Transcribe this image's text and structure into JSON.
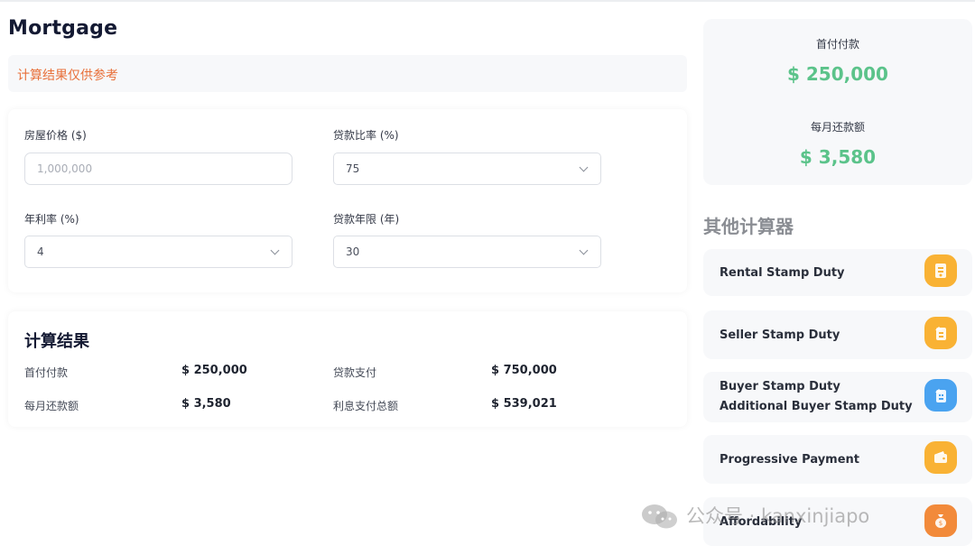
{
  "page": {
    "title": "Mortgage",
    "notice": "计算结果仅供参考"
  },
  "form": {
    "house_price": {
      "label": "房屋价格 ($)",
      "value": "",
      "placeholder": "1,000,000"
    },
    "loan_ratio": {
      "label": "贷款比率 (%)",
      "value": "75"
    },
    "annual_rate": {
      "label": "年利率 (%)",
      "value": "4"
    },
    "loan_term": {
      "label": "贷款年限 (年)",
      "value": "30"
    }
  },
  "results": {
    "title": "计算结果",
    "down_payment": {
      "label": "首付付款",
      "value": "$ 250,000"
    },
    "loan_payment": {
      "label": "贷款支付",
      "value": "$ 750,000"
    },
    "monthly_payment": {
      "label": "每月还款额",
      "value": "$ 3,580"
    },
    "total_interest": {
      "label": "利息支付总额",
      "value": "$ 539,021"
    }
  },
  "summary": {
    "down_payment": {
      "label": "首付付款",
      "value": "$ 250,000"
    },
    "monthly_payment": {
      "label": "每月还款额",
      "value": "$ 3,580"
    },
    "value_color": "#5bc38a"
  },
  "other_calculators": {
    "title": "其他计算器",
    "items": [
      {
        "lines": [
          "Rental Stamp Duty"
        ],
        "icon": "document-stamp-icon",
        "icon_color": "#f9b234"
      },
      {
        "lines": [
          "Seller Stamp Duty"
        ],
        "icon": "house-document-icon",
        "icon_color": "#f9b234"
      },
      {
        "lines": [
          "Buyer Stamp Duty",
          "Additional Buyer Stamp Duty"
        ],
        "icon": "building-document-icon",
        "icon_color": "#4aa3f0"
      },
      {
        "lines": [
          "Progressive Payment"
        ],
        "icon": "wallet-icon",
        "icon_color": "#f9b234"
      },
      {
        "lines": [
          "Affordability"
        ],
        "icon": "money-bag-icon",
        "icon_color": "#f28a3a"
      }
    ]
  },
  "watermark": {
    "text": "公众号 · kanxinjiapo"
  }
}
